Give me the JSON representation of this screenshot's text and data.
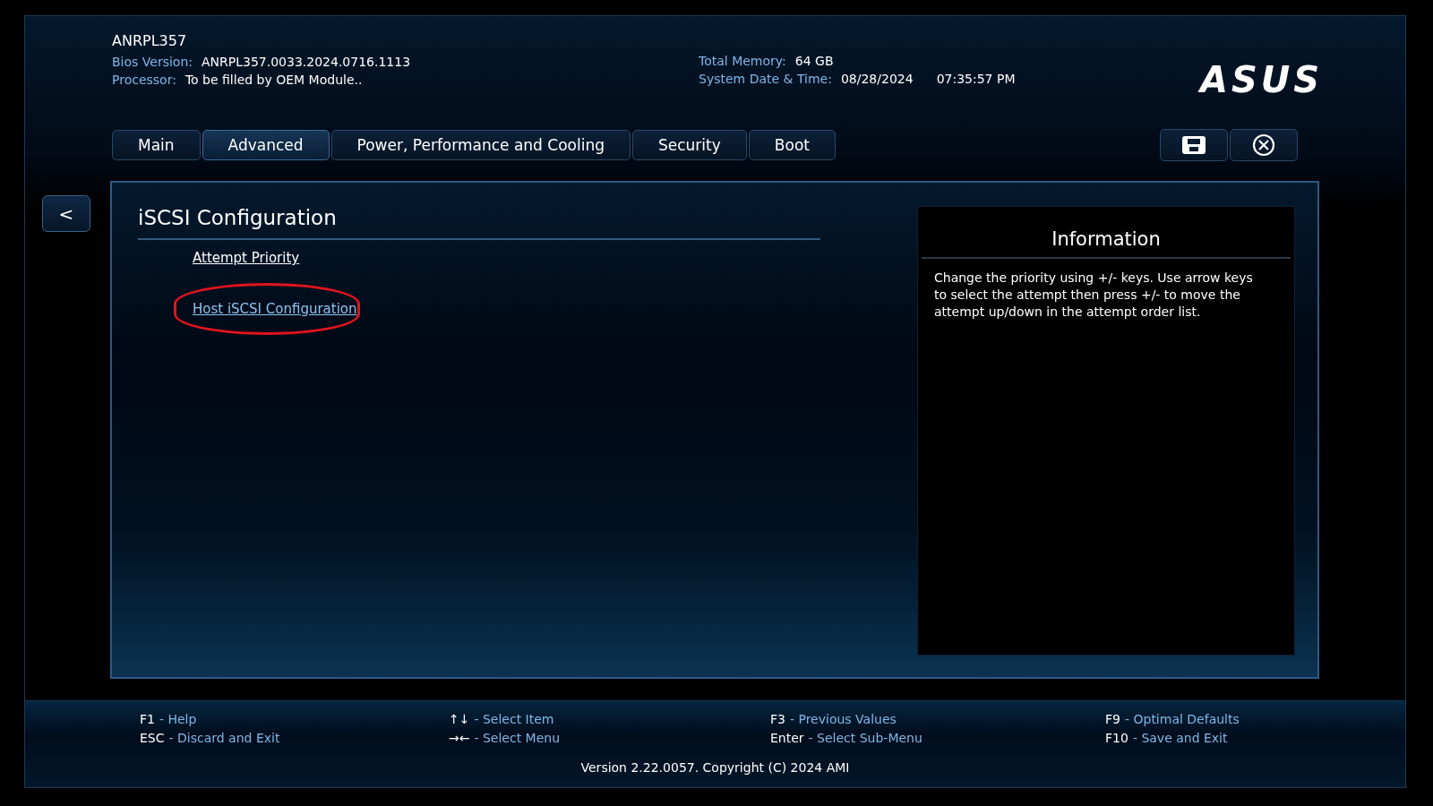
{
  "header": {
    "model": "ANRPL357",
    "fields": [
      {
        "label": "Bios Version:",
        "value": "ANRPL357.0033.2024.0716.1113"
      },
      {
        "label": "Processor:",
        "value": "To be filled by OEM Module.."
      }
    ],
    "right_fields": [
      {
        "label": "Total Memory:",
        "values": [
          "64 GB"
        ]
      },
      {
        "label": "System Date & Time:",
        "values": [
          "08/28/2024",
          "07:35:57 PM"
        ]
      }
    ],
    "logo": "ASUS"
  },
  "tabs": [
    {
      "label": "Main",
      "selected": false
    },
    {
      "label": "Advanced",
      "selected": true
    },
    {
      "label": "Power, Performance and Cooling",
      "selected": false
    },
    {
      "label": "Security",
      "selected": false
    },
    {
      "label": "Boot",
      "selected": false
    }
  ],
  "back_button": "<",
  "page": {
    "title": "iSCSI Configuration",
    "items": [
      {
        "label": "Attempt Priority",
        "selected": false,
        "circled": false
      },
      {
        "label": "Host iSCSI Configuration",
        "selected": true,
        "circled": true
      }
    ]
  },
  "information": {
    "title": "Information",
    "text": "Change the priority using +/- keys. Use arrow keys to select the attempt then press +/- to move the attempt up/down in the attempt order list."
  },
  "footer": {
    "columns": [
      [
        {
          "key": "F1",
          "action": "- Help"
        },
        {
          "key": "ESC",
          "action": "- Discard and Exit"
        }
      ],
      [
        {
          "key": "↑↓",
          "action": "- Select Item"
        },
        {
          "key": "→←",
          "action": "- Select Menu"
        }
      ],
      [
        {
          "key": "F3",
          "action": "- Previous Values"
        },
        {
          "key": "Enter",
          "action": "- Select Sub-Menu"
        }
      ],
      [
        {
          "key": "F9",
          "action": "- Optimal Defaults"
        },
        {
          "key": "F10",
          "action": "- Save and Exit"
        }
      ]
    ],
    "version": "Version 2.22.0057. Copyright (C) 2024 AMI"
  }
}
